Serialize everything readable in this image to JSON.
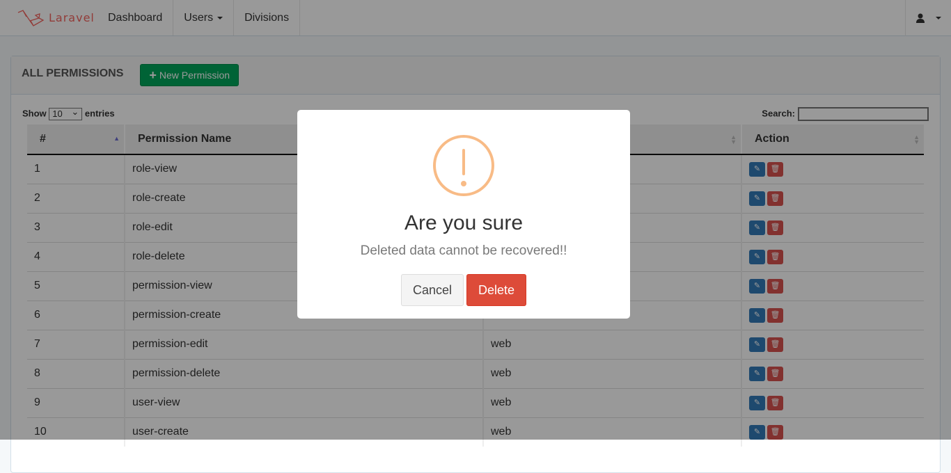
{
  "navbar": {
    "brand": "Laravel",
    "items": [
      {
        "label": "Dashboard"
      },
      {
        "label": "Users",
        "dropdown": true
      },
      {
        "label": "Divisions"
      }
    ],
    "user_icon": "user-icon"
  },
  "panel": {
    "title": "ALL PERMISSIONS",
    "new_button": "New Permission"
  },
  "table_controls": {
    "show_label": "Show",
    "entries_value": "10",
    "entries_label": "entries",
    "search_label": "Search:",
    "search_value": ""
  },
  "table": {
    "columns": [
      "#",
      "Permission Name",
      "",
      "Action"
    ],
    "rows": [
      {
        "id": "1",
        "name": "role-view",
        "guard": ""
      },
      {
        "id": "2",
        "name": "role-create",
        "guard": ""
      },
      {
        "id": "3",
        "name": "role-edit",
        "guard": ""
      },
      {
        "id": "4",
        "name": "role-delete",
        "guard": ""
      },
      {
        "id": "5",
        "name": "permission-view",
        "guard": ""
      },
      {
        "id": "6",
        "name": "permission-create",
        "guard": ""
      },
      {
        "id": "7",
        "name": "permission-edit",
        "guard": "web"
      },
      {
        "id": "8",
        "name": "permission-delete",
        "guard": "web"
      },
      {
        "id": "9",
        "name": "user-view",
        "guard": "web"
      },
      {
        "id": "10",
        "name": "user-create",
        "guard": "web"
      }
    ]
  },
  "modal": {
    "icon": "warning-icon",
    "title": "Are you sure",
    "text": "Deleted data cannot be recovered!!",
    "cancel": "Cancel",
    "confirm": "Delete",
    "colors": {
      "warning": "#f8bb86",
      "delete": "#dd4b39"
    }
  }
}
